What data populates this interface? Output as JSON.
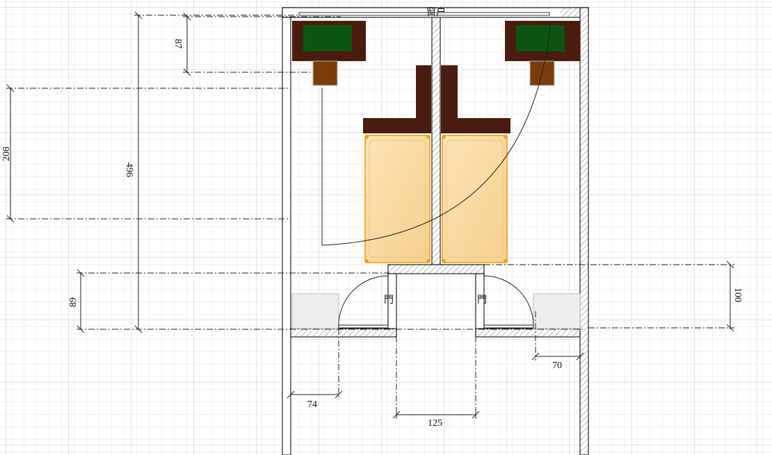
{
  "labels": {
    "window": "窗户",
    "door_left": "門",
    "door_right": "門"
  },
  "dimensions": {
    "d87": "87",
    "d208": "208",
    "d496": "496",
    "d89": "89",
    "d100": "100",
    "d74": "74",
    "d125": "125",
    "d70": "70"
  },
  "colors": {
    "grid_minor": "#e0e0e0",
    "grid_major": "#c4c4c4",
    "wall_hatch": "#888888",
    "desk_dark": "#4a1c10",
    "desk_green": "#0d5410",
    "chair_brown": "#7a3d0a",
    "bed_fill": "#fad9a0",
    "bed_border": "#f0b030",
    "cabinet": "#eeeeee"
  }
}
